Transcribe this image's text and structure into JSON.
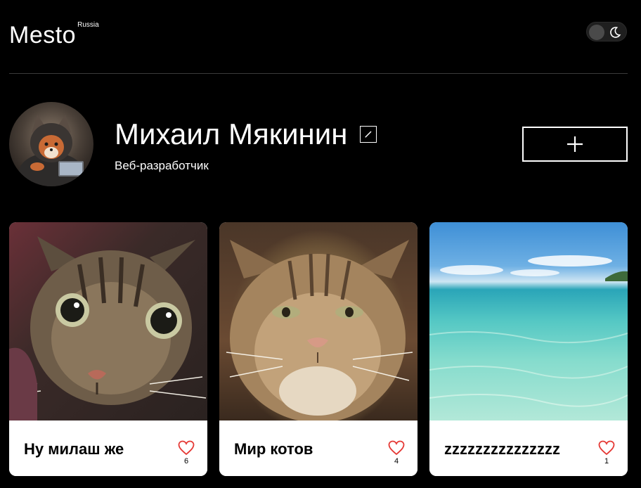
{
  "header": {
    "logo": "Mesto",
    "logo_sup": "Russia",
    "theme_icon": "moon-icon"
  },
  "profile": {
    "name": "Михаил Мякинин",
    "about": "Веб-разработчик",
    "edit_icon": "pencil-icon",
    "add_icon": "plus-icon"
  },
  "cards": [
    {
      "title": "Ну милаш же",
      "likes": "6",
      "image": "fluffy tabby kitten"
    },
    {
      "title": "Мир котов",
      "likes": "4",
      "image": "grumpy tabby cat"
    },
    {
      "title": "zzzzzzzzzzzzzzz",
      "likes": "1",
      "image": "turquoise sea and sky"
    }
  ],
  "colors": {
    "background": "#000000",
    "text": "#ffffff",
    "card": "#ffffff",
    "like": "#e53935",
    "divider": "#3a3a3a"
  }
}
